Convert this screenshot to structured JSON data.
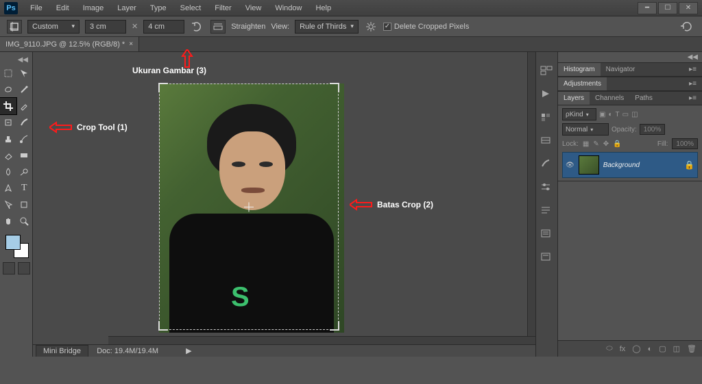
{
  "menubar": {
    "items": [
      "File",
      "Edit",
      "Image",
      "Layer",
      "Type",
      "Select",
      "Filter",
      "View",
      "Window",
      "Help"
    ]
  },
  "options": {
    "preset": "Custom",
    "width": "3 cm",
    "height": "4 cm",
    "straighten_label": "Straighten",
    "view_label": "View:",
    "overlay": "Rule of Thirds",
    "delete_cropped_label": "Delete Cropped Pixels"
  },
  "document_tab": "IMG_9110.JPG @ 12.5% (RGB/8) *",
  "annotations": {
    "crop_tool": "Crop Tool  (1)",
    "batas_crop": "Batas Crop  (2)",
    "ukuran_gambar": "Ukuran Gambar  (3)"
  },
  "panels": {
    "histogram_tab": "Histogram",
    "navigator_tab": "Navigator",
    "adjustments_tab": "Adjustments",
    "layers_tab": "Layers",
    "channels_tab": "Channels",
    "paths_tab": "Paths",
    "kind_label": "Kind",
    "blend_mode": "Normal",
    "opacity_label": "Opacity:",
    "opacity_value": "100%",
    "lock_label": "Lock:",
    "fill_label": "Fill:",
    "fill_value": "100%",
    "background_layer": "Background"
  },
  "status": {
    "zoom": "12.5%",
    "doc_info": "Doc: 19.4M/19.4M"
  },
  "mini_bridge_label": "Mini Bridge"
}
